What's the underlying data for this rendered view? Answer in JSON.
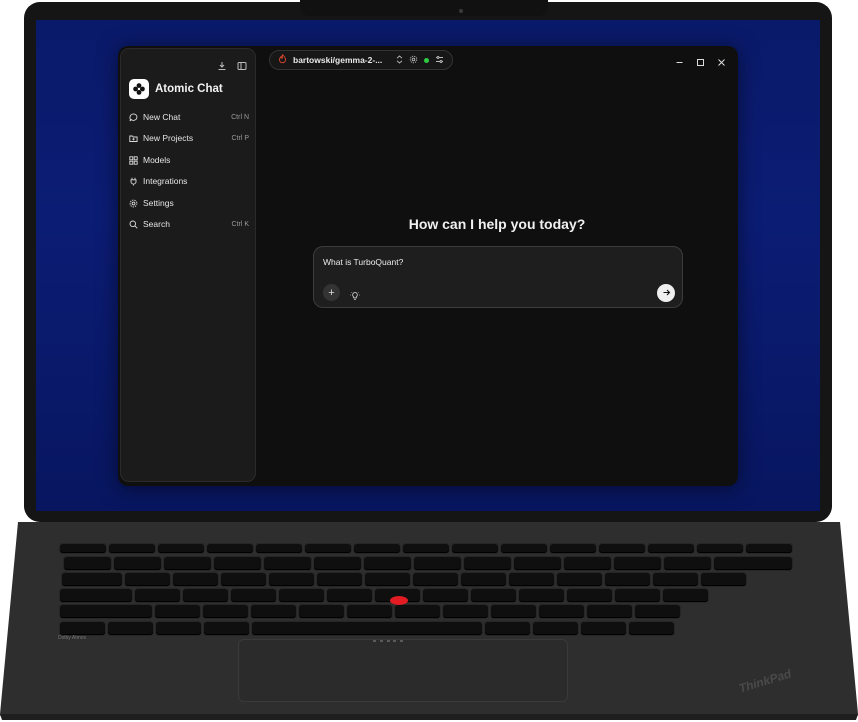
{
  "app": {
    "title": "Atomic Chat",
    "model_selector": "bartowski/gemma-2-..."
  },
  "sidebar": {
    "items": [
      {
        "label": "New Chat",
        "shortcut": "Ctrl N",
        "icon": "chat-bubble-icon"
      },
      {
        "label": "New Projects",
        "shortcut": "Ctrl P",
        "icon": "folder-plus-icon"
      },
      {
        "label": "Models",
        "shortcut": "",
        "icon": "grid-icon"
      },
      {
        "label": "Integrations",
        "shortcut": "",
        "icon": "plug-icon"
      },
      {
        "label": "Settings",
        "shortcut": "",
        "icon": "gear-icon"
      },
      {
        "label": "Search",
        "shortcut": "Ctrl K",
        "icon": "search-icon"
      }
    ]
  },
  "main": {
    "greeting": "How can I help you today?",
    "composer": {
      "value": "What is TurboQuant?"
    }
  },
  "device": {
    "audio_badge": "Dolby Atmos",
    "brand": "ThinkPad"
  },
  "colors": {
    "wallpaper": "#0b1c74",
    "app_bg": "#0f0f0f",
    "sidebar_bg": "#1b1b1b",
    "status_online": "#2ecc40",
    "trackpoint": "#e31b23"
  }
}
